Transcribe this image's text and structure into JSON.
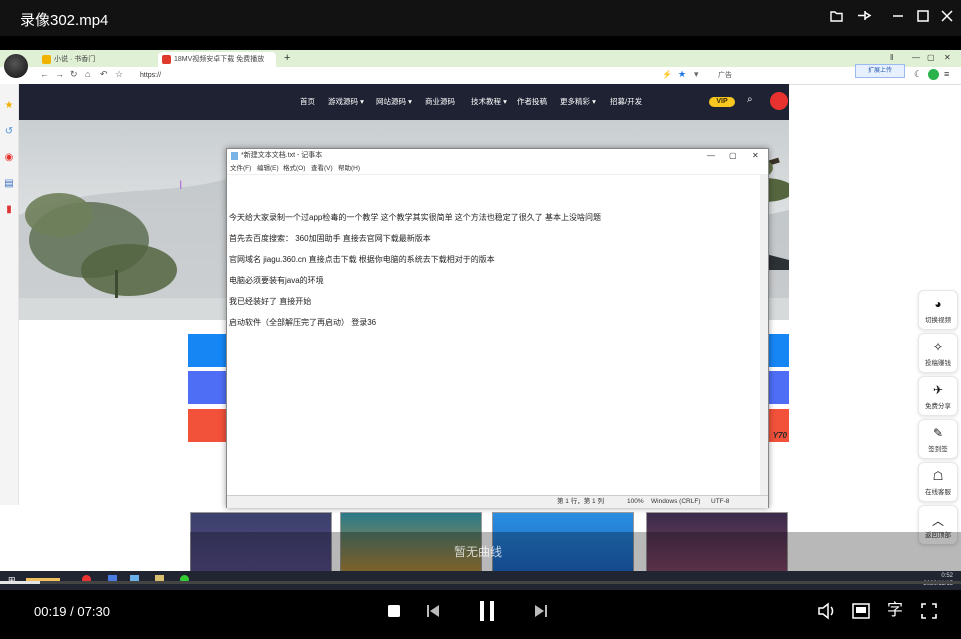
{
  "window": {
    "title": "录像302.mp4"
  },
  "browser": {
    "tabs": [
      {
        "label": "小说 · 书香门",
        "favicon_color": "#f0b400"
      },
      {
        "label": "18MV视频安卓下载 免费播放",
        "favicon_color": "#e03a2d"
      }
    ],
    "url": "https://",
    "search_box": "广告",
    "plugin_badge": "扩展上传",
    "sidebar_icons": [
      "star-icon",
      "history-icon",
      "weibo-icon",
      "bookmark-icon",
      "doc-icon"
    ]
  },
  "site": {
    "nav": [
      "首页",
      "游戏源码 ▾",
      "网站源码 ▾",
      "商业源码",
      "技术教程 ▾",
      "作者投稿",
      "更多精彩 ▾",
      "招募/开发"
    ],
    "vip": "VIP",
    "price_tag": "Y70"
  },
  "notepad": {
    "title": "*新建文本文档.txt - 记事本",
    "menu": [
      "文件(F)",
      "编辑(E)",
      "格式(O)",
      "查看(V)",
      "帮助(H)"
    ],
    "lines": [
      "今天给大家录制一个过app检毒的一个教学 这个教学其实很简单 这个方法也稳定了很久了 基本上没啥问题",
      "首先去百度搜索：  360加固助手 直接去官网下载最新版本",
      "官网域名 jiagu.360.cn  直接点击下载 根据你电脑的系统去下载相对于的版本",
      "电脑必须要装有java的环境",
      "我已经装好了 直接开始",
      "启动软件（全部解压完了再启动） 登录36"
    ],
    "status": {
      "position": "第 1 行，第 1 列",
      "zoom": "100%",
      "eol": "Windows (CRLF)",
      "encoding": "UTF-8"
    }
  },
  "right_sidebar": [
    {
      "label": "切换视频",
      "icon": "switch-icon"
    },
    {
      "label": "投稿赚钱",
      "icon": "money-icon"
    },
    {
      "label": "免费分享",
      "icon": "share-icon"
    },
    {
      "label": "签到签",
      "icon": "checkin-icon"
    },
    {
      "label": "在线客服",
      "icon": "chat-icon"
    },
    {
      "label": "返回顶部",
      "icon": "top-icon"
    }
  ],
  "thumbnail_banner": "暂无曲线",
  "taskbar": {
    "time": "0:52",
    "date": "2020/11/15"
  },
  "player": {
    "current_time": "00:19",
    "separator": " / ",
    "total_time": "07:30",
    "progress": 0.042,
    "subtitle_label": "字"
  }
}
